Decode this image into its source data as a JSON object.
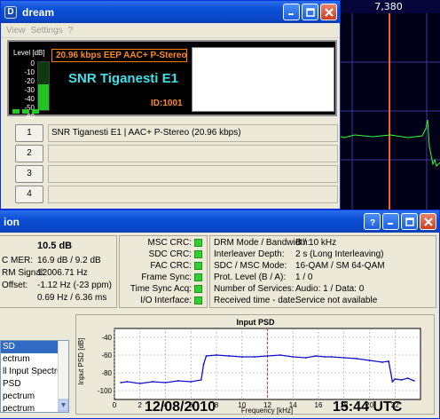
{
  "scope": {
    "frequency_label": "7,380"
  },
  "dream": {
    "title": "dream",
    "menu": [
      "View",
      "Settings",
      "?"
    ],
    "level_label": "Level [dB]",
    "level_ticks": [
      "0",
      "-10",
      "-20",
      "-30",
      "-40",
      "-50",
      "-60"
    ],
    "level_value_db": -28,
    "bitrate_text": "20.96 kbps EEP  AAC+  P-Stereo",
    "station_name": "SNR Tiganesti E1",
    "station_id": "ID:1001",
    "services": [
      {
        "number": "1",
        "label": "SNR Tiganesti E1  |  AAC+ P-Stereo (20.96 kbps)"
      },
      {
        "number": "2",
        "label": ""
      },
      {
        "number": "3",
        "label": ""
      },
      {
        "number": "4",
        "label": ""
      }
    ]
  },
  "sysev": {
    "title_fragment": "ion",
    "snr_value": "10.5 dB",
    "measurements": [
      {
        "label": "C MER:",
        "value": "16.9 dB / 9.2 dB"
      },
      {
        "label": "RM Signal:",
        "value": "12006.71 Hz"
      },
      {
        "label": "Offset:",
        "value": "-1.12 Hz (-23 ppm)"
      },
      {
        "label": "",
        "value": "0.69 Hz / 6.36 ms"
      }
    ],
    "indicators": [
      "MSC CRC:",
      "SDC CRC:",
      "FAC CRC:",
      "Frame Sync:",
      "Time Sync Acq:",
      "I/O Interface:"
    ],
    "drm_info": [
      {
        "label": "DRM Mode / Bandwidth:",
        "value": "B / 10 kHz"
      },
      {
        "label": "Interleaver Depth:",
        "value": "2 s (Long Interleaving)"
      },
      {
        "label": "SDC / MSC Mode:",
        "value": "16-QAM / SM 64-QAM"
      },
      {
        "label": "Prot. Level (B / A):",
        "value": "1 / 0"
      },
      {
        "label": "Number of Services:",
        "value": "Audio: 1 / Data: 0"
      },
      {
        "label": "Received time - date:",
        "value": "Service not available"
      }
    ],
    "list_items": [
      {
        "label": "SD",
        "selected": true
      },
      {
        "label": "ectrum",
        "selected": false
      },
      {
        "label": "ll Input Spectrum",
        "selected": false
      },
      {
        "label": "PSD",
        "selected": false
      },
      {
        "label": "pectrum",
        "selected": false
      },
      {
        "label": "pectrum",
        "selected": false
      }
    ],
    "date_overlay": "12/08/2010",
    "time_overlay": "15:44 UTC"
  },
  "chart_data": {
    "type": "line",
    "title": "Input PSD",
    "xlabel": "Frequency [kHz]",
    "ylabel": "Input PSD [dB]",
    "xlim": [
      0,
      24
    ],
    "ylim": [
      -110,
      -30
    ],
    "x_ticks": [
      "0",
      "2",
      "4",
      "6",
      "8",
      "10",
      "12",
      "14",
      "16",
      "18",
      "20",
      "22"
    ],
    "y_ticks": [
      "-40",
      "-60",
      "-80",
      "-100"
    ],
    "marker_x": 12,
    "series": [
      {
        "color": "#1010c8",
        "x": [
          0.5,
          1,
          2,
          3,
          4,
          5,
          6,
          6.8,
          7,
          7.2,
          8,
          9,
          10,
          11,
          12,
          13,
          14,
          15,
          15.8,
          16.5,
          17,
          18,
          19,
          20,
          21,
          21.5,
          21.8,
          22,
          22.5,
          23,
          23.5
        ],
        "y": [
          -91,
          -90,
          -92,
          -90,
          -91,
          -89,
          -90,
          -88,
          -70,
          -61,
          -60,
          -61,
          -62,
          -62,
          -61,
          -60,
          -62,
          -63,
          -61,
          -62,
          -62,
          -63,
          -64,
          -66,
          -68,
          -67,
          -90,
          -87,
          -88,
          -86,
          -89
        ]
      }
    ]
  },
  "colors": {
    "titlebar": "#0a4ed4",
    "psd_line": "#1010c8",
    "marker": "#ff3030",
    "station_text": "#40e0e8",
    "bitrate_text": "#ff8c1a"
  }
}
